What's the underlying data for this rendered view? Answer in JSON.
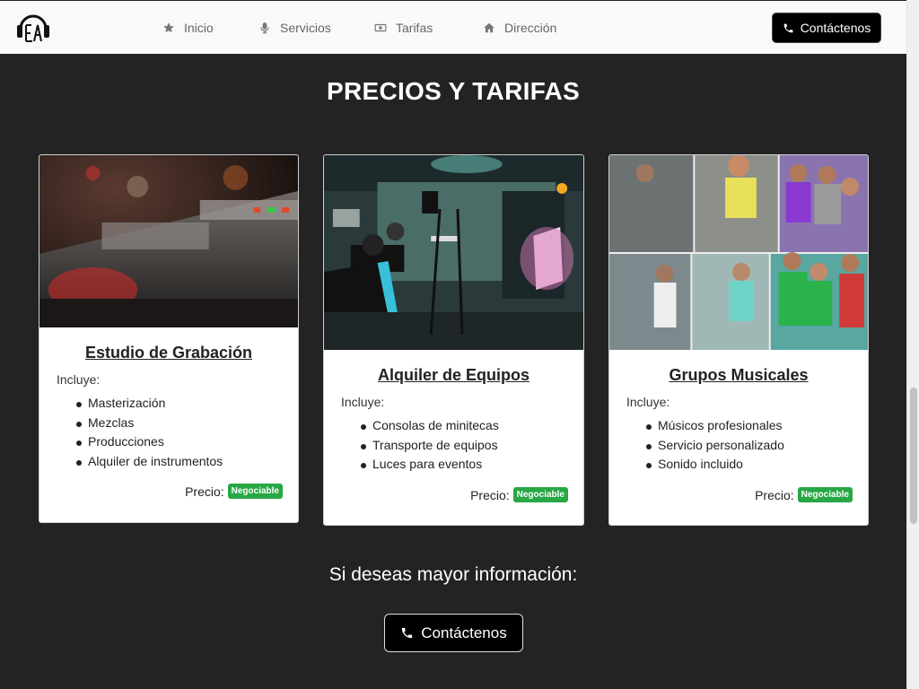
{
  "nav": {
    "items": [
      {
        "label": "Inicio",
        "icon": "star-icon"
      },
      {
        "label": "Servicios",
        "icon": "microphone-icon"
      },
      {
        "label": "Tarifas",
        "icon": "money-icon"
      },
      {
        "label": "Dirección",
        "icon": "home-icon"
      }
    ],
    "contact_label": "Contáctenos"
  },
  "section": {
    "title": "PRECIOS Y TARIFAS"
  },
  "cards": [
    {
      "title": "Estudio de Grabación",
      "includes_label": "Incluye:",
      "items": [
        "Masterización",
        "Mezclas",
        "Producciones",
        "Alquiler de instrumentos"
      ],
      "price_label": "Precio:",
      "price_badge": "Negociable"
    },
    {
      "title": "Alquiler de Equipos",
      "includes_label": "Incluye:",
      "items": [
        "Consolas de minitecas",
        "Transporte de equipos",
        "Luces para eventos"
      ],
      "price_label": "Precio:",
      "price_badge": "Negociable"
    },
    {
      "title": "Grupos Musicales",
      "includes_label": "Incluye:",
      "items": [
        "Músicos profesionales",
        "Servicio personalizado",
        "Sonido incluido"
      ],
      "price_label": "Precio:",
      "price_badge": "Negociable"
    }
  ],
  "footer": {
    "more_info": "Si deseas mayor información:",
    "contact_label": "Contáctenos"
  },
  "colors": {
    "background": "#232323",
    "navbar": "#f8f9fa",
    "badge": "#28a745",
    "button": "#000000"
  }
}
